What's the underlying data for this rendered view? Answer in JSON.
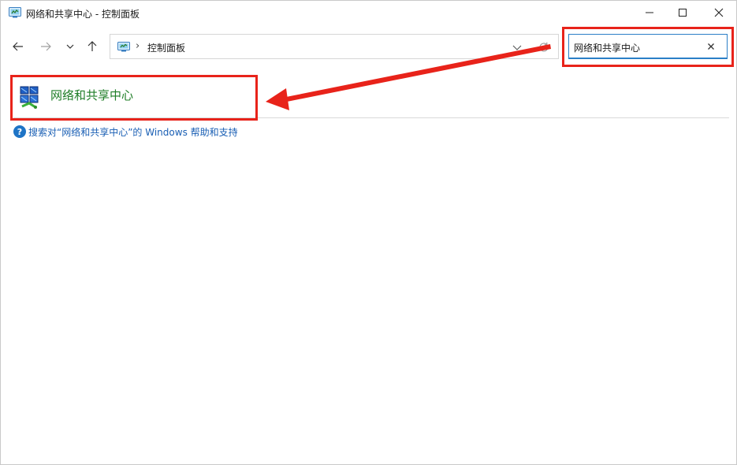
{
  "window": {
    "title": "网络和共享中心 - 控制面板",
    "icon": "control-panel-icon",
    "controls": [
      "minimize-icon",
      "maximize-icon",
      "close-icon"
    ]
  },
  "navigation": {
    "back_icon": "arrow-left-icon",
    "forward_icon": "arrow-right-icon",
    "recent_icon": "chevron-down-icon",
    "up_icon": "arrow-up-icon"
  },
  "address_bar": {
    "icon": "control-panel-icon",
    "separator": "›",
    "path": "控制面板",
    "dropdown_icon": "chevron-down-icon",
    "refresh_icon": "refresh-icon"
  },
  "search": {
    "value": "网络和共享中心",
    "clear_label": "×"
  },
  "results": [
    {
      "label": "网络和共享中心",
      "icon": "network-sharing-center-icon"
    }
  ],
  "help": {
    "icon_label": "?",
    "text": "搜索对“网络和共享中心”的 Windows 帮助和支持"
  },
  "annotations": {
    "highlight_color": "#e8231a"
  },
  "colors": {
    "result_link": "#1e7d26",
    "help_link": "#1a5fb4",
    "search_focus": "#2b7fc7"
  }
}
